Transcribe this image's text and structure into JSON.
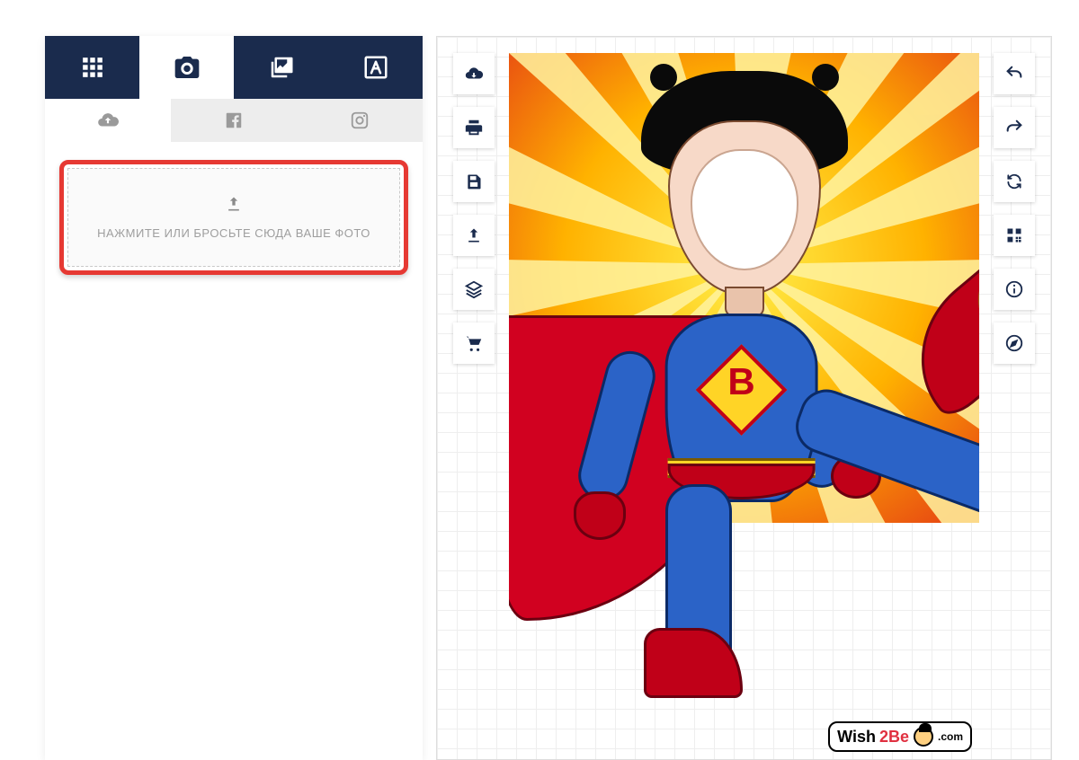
{
  "colors": {
    "navy": "#1a2b4d",
    "highlight": "#e63933"
  },
  "main_tabs": [
    {
      "name": "templates",
      "icon": "grid-icon"
    },
    {
      "name": "photo",
      "icon": "camera-icon",
      "active": true
    },
    {
      "name": "layers",
      "icon": "images-icon"
    },
    {
      "name": "text",
      "icon": "text-icon"
    }
  ],
  "sub_tabs": [
    {
      "name": "upload",
      "icon": "cloud-upload-icon",
      "active": true
    },
    {
      "name": "facebook",
      "icon": "facebook-icon"
    },
    {
      "name": "instagram",
      "icon": "instagram-icon"
    }
  ],
  "upload": {
    "icon": "upload-icon",
    "label": "НАЖМИТЕ ИЛИ БРОСЬТЕ СЮДА ВАШЕ ФОТО"
  },
  "left_toolbar": [
    {
      "name": "download",
      "icon": "cloud-download-icon"
    },
    {
      "name": "print",
      "icon": "print-icon"
    },
    {
      "name": "save",
      "icon": "save-icon"
    },
    {
      "name": "upload",
      "icon": "upload-icon"
    },
    {
      "name": "layers",
      "icon": "layers-icon"
    },
    {
      "name": "cart",
      "icon": "cart-icon"
    }
  ],
  "right_toolbar": [
    {
      "name": "undo",
      "icon": "undo-icon"
    },
    {
      "name": "redo",
      "icon": "redo-icon"
    },
    {
      "name": "refresh",
      "icon": "refresh-icon"
    },
    {
      "name": "qr",
      "icon": "qr-icon"
    },
    {
      "name": "info",
      "icon": "info-icon"
    },
    {
      "name": "explore",
      "icon": "compass-icon"
    }
  ],
  "canvas": {
    "chest_letter": "B",
    "watermark": {
      "part1": "Wish",
      "part2": "2Be",
      "suffix": ".com"
    }
  }
}
